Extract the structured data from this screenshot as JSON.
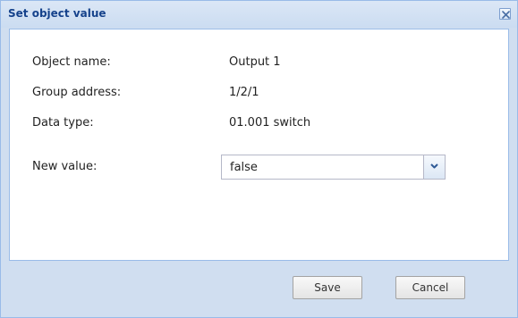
{
  "dialog": {
    "title": "Set object value",
    "close_icon": "close-icon"
  },
  "fields": {
    "object_name": {
      "label": "Object name:",
      "value": "Output 1"
    },
    "group_address": {
      "label": "Group address:",
      "value": "1/2/1"
    },
    "data_type": {
      "label": "Data type:",
      "value": "01.001 switch"
    },
    "new_value": {
      "label": "New value:",
      "value": "false",
      "trigger_icon": "chevron-down-icon"
    }
  },
  "buttons": {
    "save": "Save",
    "cancel": "Cancel"
  },
  "colors": {
    "title_text": "#15428b",
    "window_border": "#99bbe8",
    "footer_background": "#d0def0"
  }
}
